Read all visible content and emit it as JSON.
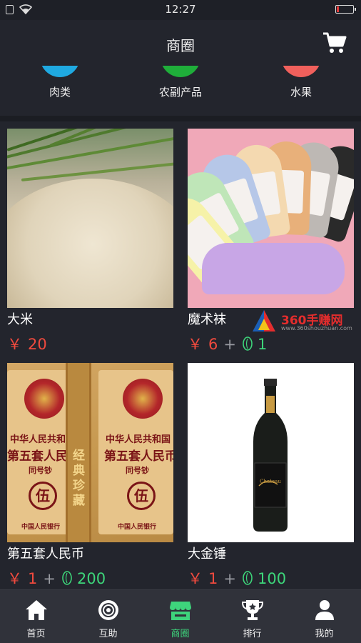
{
  "status_bar": {
    "time": "12:27"
  },
  "header": {
    "title": "商圈"
  },
  "categories": [
    {
      "label": "肉类",
      "color": "#1fa9e1"
    },
    {
      "label": "农副产品",
      "color": "#1fae3a"
    },
    {
      "label": "水果",
      "color": "#f0605c"
    }
  ],
  "products": [
    {
      "name": "大米",
      "currency": "￥",
      "price": "20",
      "plus": "",
      "points": ""
    },
    {
      "name": "魔术袜",
      "currency": "￥",
      "price": "6",
      "plus": "+",
      "points": "1"
    },
    {
      "name": "第五套人民币",
      "currency": "￥",
      "price": "1",
      "plus": "+",
      "points": "200"
    },
    {
      "name": "大金锤",
      "currency": "￥",
      "price": "1",
      "plus": "+",
      "points": "100"
    }
  ],
  "money_image": {
    "line1": "中华人民共和",
    "line1b": "中华人民共和国",
    "line2": "第五套人民币",
    "line3": "同号钞",
    "digit": "伍",
    "ribbon": "经典珍藏",
    "bank": "中国人民银行"
  },
  "wine_image": {
    "label": "Chateau"
  },
  "watermark": {
    "title": "360手赚网",
    "url": "www.360shouzhuan.com"
  },
  "tabs": [
    {
      "label": "首页",
      "icon": "home-icon"
    },
    {
      "label": "互助",
      "icon": "circle-icon"
    },
    {
      "label": "商圈",
      "icon": "shop-icon"
    },
    {
      "label": "排行",
      "icon": "trophy-icon"
    },
    {
      "label": "我的",
      "icon": "user-icon"
    }
  ],
  "colors": {
    "accent_green": "#3ed47c",
    "price_red": "#f04a3e",
    "background": "#23252d"
  }
}
